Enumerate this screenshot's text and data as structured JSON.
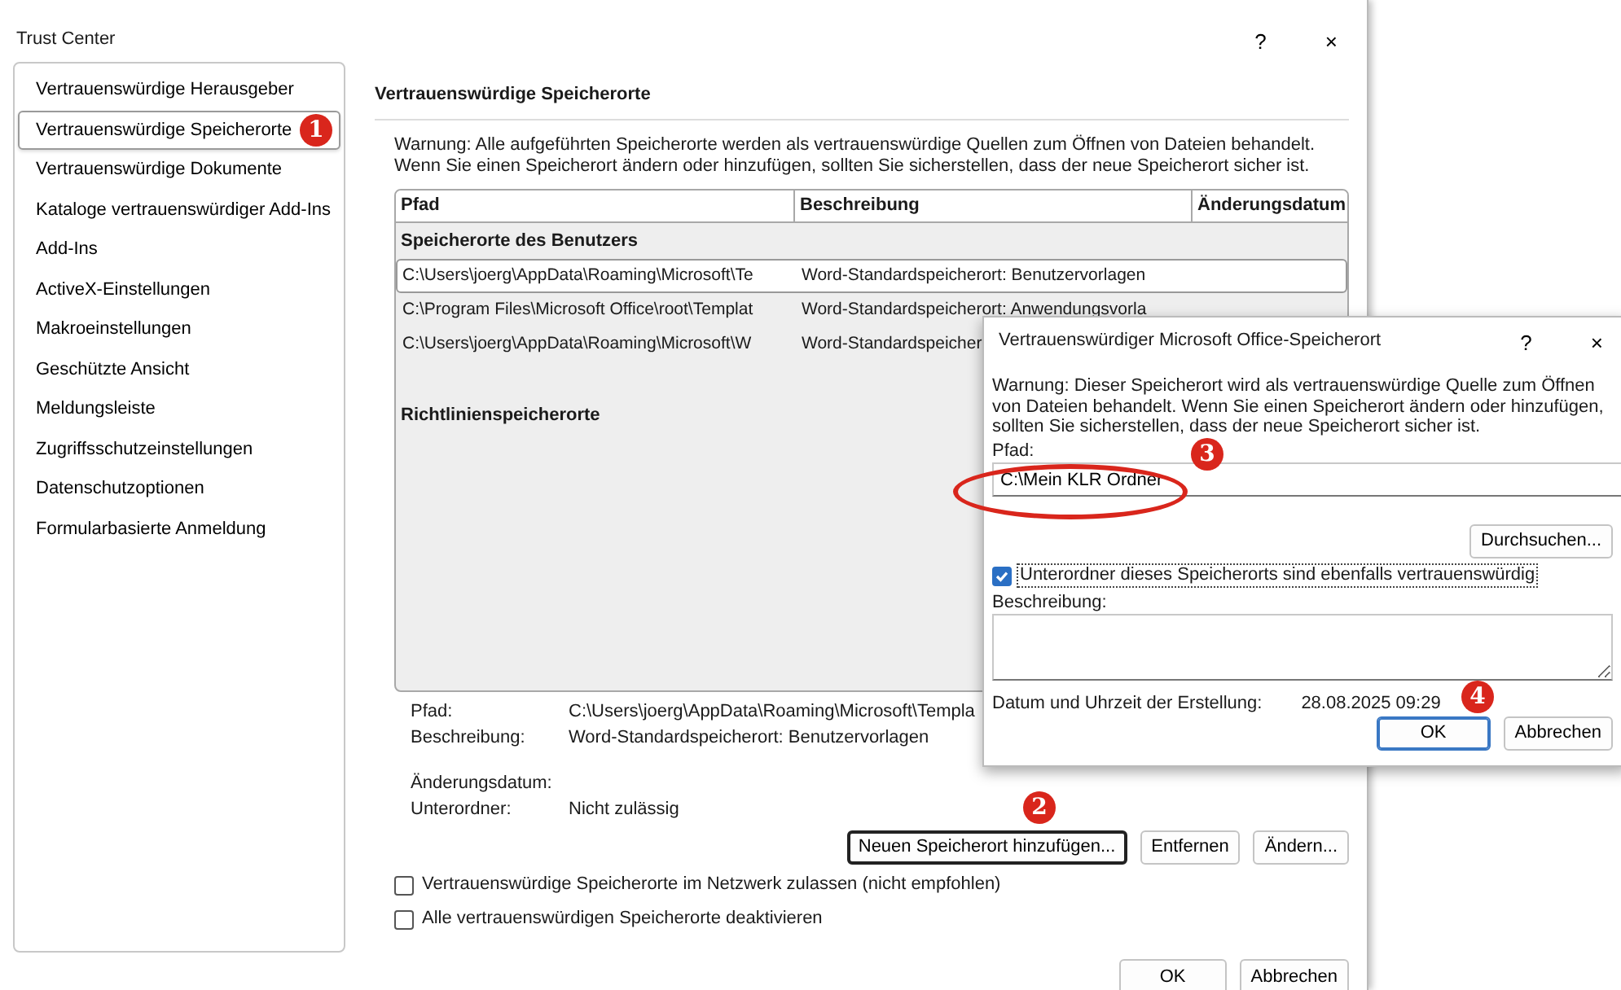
{
  "window": {
    "title": "Trust Center",
    "help": "?",
    "close": "×"
  },
  "sidebar": {
    "items": [
      {
        "label": "Vertrauenswürdige Herausgeber",
        "selected": false
      },
      {
        "label": "Vertrauenswürdige Speicherorte",
        "selected": true,
        "marker": "1"
      },
      {
        "label": "Vertrauenswürdige Dokumente",
        "selected": false
      },
      {
        "label": "Kataloge vertrauenswürdiger Add-Ins",
        "selected": false
      },
      {
        "label": "Add-Ins",
        "selected": false
      },
      {
        "label": "ActiveX-Einstellungen",
        "selected": false
      },
      {
        "label": "Makroeinstellungen",
        "selected": false
      },
      {
        "label": "Geschützte Ansicht",
        "selected": false
      },
      {
        "label": "Meldungsleiste",
        "selected": false
      },
      {
        "label": "Zugriffsschutzeinstellungen",
        "selected": false
      },
      {
        "label": "Datenschutzoptionen",
        "selected": false
      },
      {
        "label": "Formularbasierte Anmeldung",
        "selected": false
      }
    ]
  },
  "section_title": "Vertrauenswürdige Speicherorte",
  "warning": "Warnung: Alle aufgeführten Speicherorte werden als vertrauenswürdige Quellen zum Öffnen von Dateien behandelt. Wenn Sie einen Speicherort ändern oder hinzufügen, sollten Sie sicherstellen, dass der neue Speicherort sicher ist.",
  "table": {
    "columns": [
      "Pfad",
      "Beschreibung",
      "Änderungsdatum"
    ],
    "groups": [
      {
        "label": "Speicherorte des Benutzers",
        "rows": [
          {
            "path": "C:\\Users\\joerg\\AppData\\Roaming\\Microsoft\\Te",
            "description": "Word-Standardspeicherort: Benutzervorlagen",
            "selected": true
          },
          {
            "path": "C:\\Program Files\\Microsoft Office\\root\\Templat",
            "description": "Word-Standardspeicherort: Anwendungsvorla",
            "selected": false
          },
          {
            "path": "C:\\Users\\joerg\\AppData\\Roaming\\Microsoft\\W",
            "description": "Word-Standardspeicher",
            "selected": false
          }
        ]
      },
      {
        "label": "Richtlinienspeicherorte"
      }
    ]
  },
  "details": [
    {
      "label": "Pfad:",
      "value": "C:\\Users\\joerg\\AppData\\Roaming\\Microsoft\\Templa"
    },
    {
      "label": "Beschreibung:",
      "value": "Word-Standardspeicherort: Benutzervorlagen"
    },
    {
      "label": "Änderungsdatum:"
    },
    {
      "label": "Unterordner:",
      "value": "Nicht zulässig"
    }
  ],
  "buttons": [
    {
      "label": "Neuen Speicherort hinzufügen...",
      "focused": true,
      "marker": "2"
    },
    {
      "label": "Entfernen",
      "focused": false
    },
    {
      "label": "Ändern...",
      "focused": false
    }
  ],
  "options": [
    {
      "label": "Vertrauenswürdige Speicherorte im Netzwerk zulassen (nicht empfohlen)",
      "checked": false
    },
    {
      "label": "Alle vertrauenswürdigen Speicherorte deaktivieren",
      "checked": false
    }
  ],
  "footer_buttons": [
    {
      "label": "OK",
      "focused": false
    },
    {
      "label": "Abbrechen",
      "focused": false
    }
  ],
  "dialog": {
    "title": "Vertrauenswürdiger Microsoft Office-Speicherort",
    "help": "?",
    "close": "×",
    "warning": "Warnung: Dieser Speicherort wird als vertrauenswürdige Quelle zum Öffnen von Dateien behandelt. Wenn Sie einen Speicherort ändern oder hinzufügen, sollten Sie sicherstellen, dass der neue Speicherort sicher ist.",
    "path_label": "Pfad:",
    "path_value": "C:\\Mein KLR Ordner",
    "path_marker": "3",
    "browse_button": "Durchsuchen...",
    "subfolders": {
      "label": "Unterordner dieses Speicherorts sind ebenfalls vertrauenswürdig",
      "checked": true
    },
    "description_label": "Beschreibung:",
    "created_label": "Datum und Uhrzeit der Erstellung:",
    "created_value": "28.08.2025 09:29",
    "buttons": [
      {
        "label": "OK",
        "focused": true,
        "marker": "4"
      },
      {
        "label": "Abbrechen",
        "focused": false
      }
    ]
  }
}
